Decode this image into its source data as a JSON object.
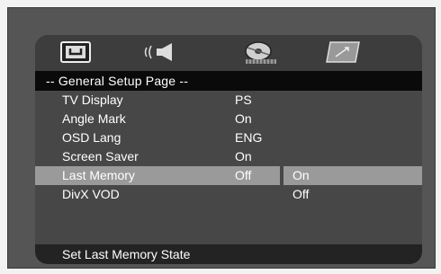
{
  "tabs": [
    {
      "icon": "general-setup-icon",
      "selected": true
    },
    {
      "icon": "audio-speaker-icon",
      "selected": false
    },
    {
      "icon": "video-disc-icon",
      "selected": false
    },
    {
      "icon": "preferences-icon",
      "selected": false
    }
  ],
  "page_title": "-- General Setup Page --",
  "menu": {
    "items": [
      {
        "label": "TV Display",
        "value": "PS"
      },
      {
        "label": "Angle Mark",
        "value": "On"
      },
      {
        "label": "OSD Lang",
        "value": "ENG"
      },
      {
        "label": "Screen Saver",
        "value": "On"
      },
      {
        "label": "Last Memory",
        "value": "Off",
        "selected": true
      },
      {
        "label": "DivX VOD",
        "value": ""
      }
    ]
  },
  "submenu": {
    "options": [
      "On",
      "Off"
    ],
    "highlighted": "On"
  },
  "status": "Set Last Memory State",
  "colors": {
    "background": "#3d3d3d",
    "header": "#0a0a0a",
    "highlight": "#9a9a9a",
    "status_bar": "#232323",
    "text": "#ffffff"
  }
}
